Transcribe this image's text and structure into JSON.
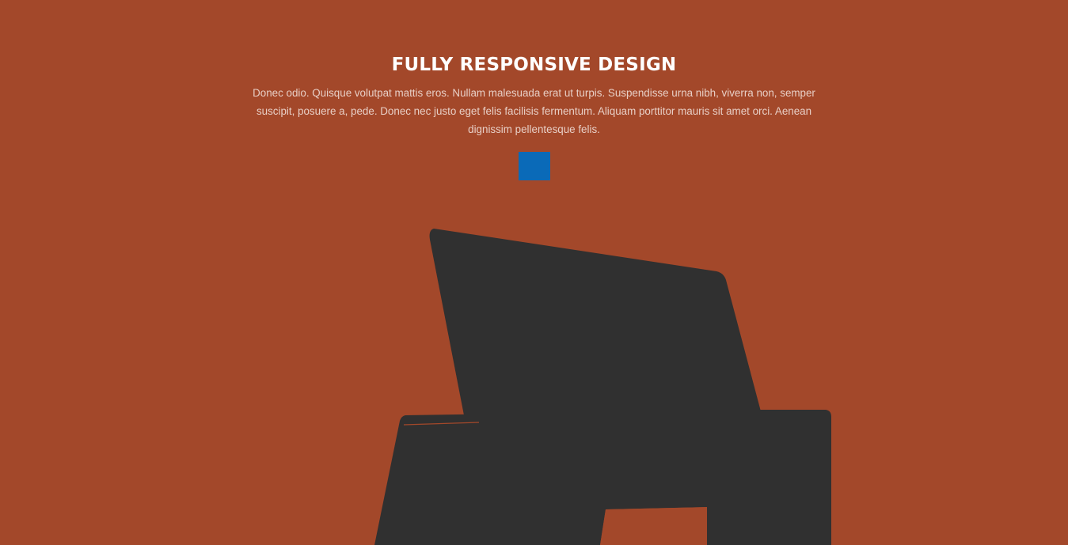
{
  "section": {
    "title": "FULLY RESPONSIVE DESIGN",
    "description": "Donec odio. Quisque volutpat mattis eros. Nullam malesuada erat ut turpis. Suspendisse urna nibh, viverra non, semper suscipit, posuere a, pede. Donec nec justo eget felis facilisis fermentum. Aliquam porttitor mauris sit amet orci. Aenean dignissim pellentesque felis."
  },
  "colors": {
    "background": "#a3482a",
    "accent": "#0a6ab8",
    "device": "#303030",
    "title": "#ffffff",
    "text": "#e8cfc6"
  },
  "devices": {
    "illustration_icon": "responsive-devices-icon"
  }
}
